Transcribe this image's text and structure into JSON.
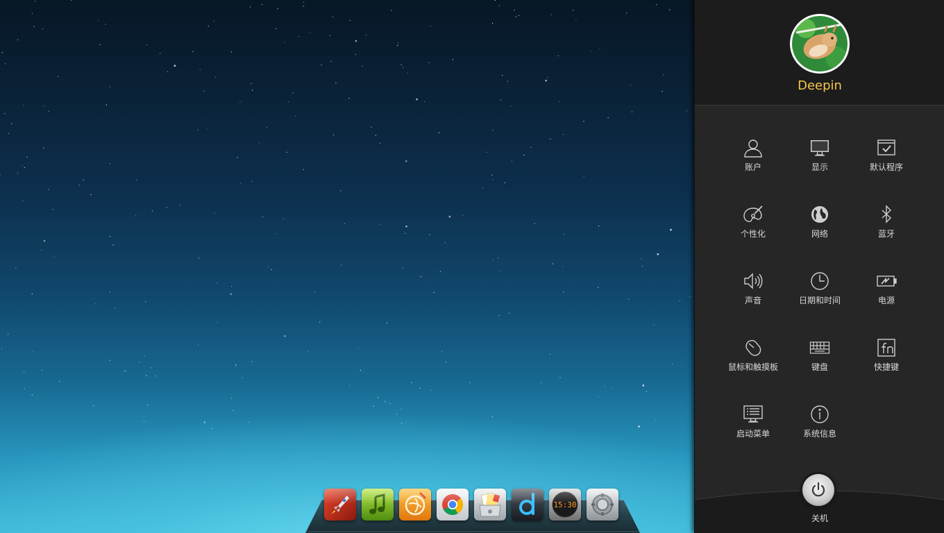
{
  "user": {
    "name": "Deepin",
    "avatar": "hamster-avatar"
  },
  "settings": {
    "items": [
      {
        "label": "账户",
        "icon": "user-icon"
      },
      {
        "label": "显示",
        "icon": "monitor-icon"
      },
      {
        "label": "默认程序",
        "icon": "default-apps-icon"
      },
      {
        "label": "个性化",
        "icon": "palette-icon"
      },
      {
        "label": "网络",
        "icon": "globe-icon"
      },
      {
        "label": "蓝牙",
        "icon": "bluetooth-icon"
      },
      {
        "label": "声音",
        "icon": "speaker-icon"
      },
      {
        "label": "日期和时间",
        "icon": "clock-icon"
      },
      {
        "label": "电源",
        "icon": "battery-icon"
      },
      {
        "label": "鼠标和触摸板",
        "icon": "mouse-icon"
      },
      {
        "label": "键盘",
        "icon": "keyboard-icon"
      },
      {
        "label": "快捷键",
        "icon": "fn-key-icon"
      },
      {
        "label": "启动菜单",
        "icon": "boot-menu-icon"
      },
      {
        "label": "系统信息",
        "icon": "info-icon"
      }
    ],
    "shutdown_label": "关机"
  },
  "dock": {
    "apps": [
      {
        "name": "launcher",
        "icon": "rocket-icon"
      },
      {
        "name": "music-player",
        "icon": "music-note-icon"
      },
      {
        "name": "media-player",
        "icon": "movie-reel-icon"
      },
      {
        "name": "chrome-browser",
        "icon": "chrome-icon"
      },
      {
        "name": "file-manager",
        "icon": "folder-drawer-icon"
      },
      {
        "name": "deepin-app",
        "icon": "d-logo-icon"
      },
      {
        "name": "clock",
        "icon": "clock-widget-icon",
        "clock_text": "15:30"
      },
      {
        "name": "system-settings",
        "icon": "settings-gear-icon"
      }
    ]
  },
  "colors": {
    "username": "#f7c64a",
    "panel_bg": "#262626",
    "label": "#d8d8d8"
  }
}
